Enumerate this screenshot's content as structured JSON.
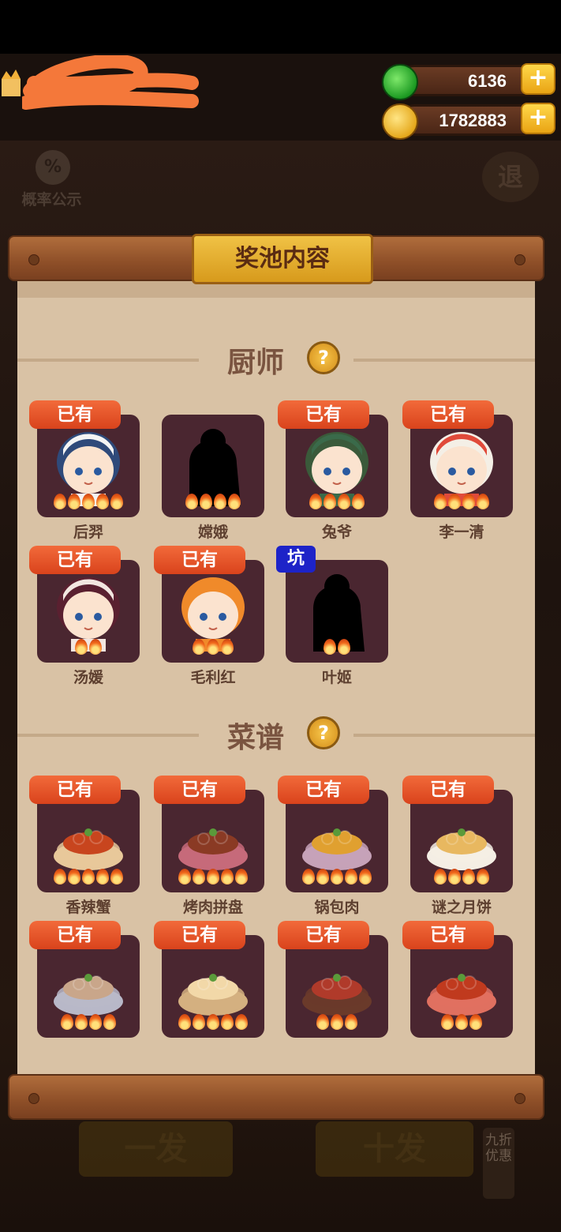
{
  "resources": {
    "gems": {
      "value": "6136",
      "icon": "green-gem-icon",
      "plus": "+"
    },
    "coins": {
      "value": "1782883",
      "icon": "gold-coin-icon",
      "plus": "+"
    }
  },
  "controls": {
    "probability": {
      "icon_text": "%",
      "label": "概率公示"
    },
    "exit": {
      "label": "退"
    }
  },
  "bottom": {
    "single": "一发",
    "ten": "十发",
    "discount": "九折优惠"
  },
  "panel": {
    "title": "奖池内容",
    "sections": {
      "chefs": {
        "title": "厨师",
        "help": "?"
      },
      "recipes": {
        "title": "菜谱",
        "help": "?"
      }
    }
  },
  "chefs": [
    {
      "name": "后羿",
      "badge": "已有",
      "stars": 5
    },
    {
      "name": "嫦娥",
      "badge": "",
      "stars": 4
    },
    {
      "name": "兔爷",
      "badge": "已有",
      "stars": 4
    },
    {
      "name": "李一清",
      "badge": "已有",
      "stars": 4
    },
    {
      "name": "汤媛",
      "badge": "已有",
      "stars": 2
    },
    {
      "name": "毛利红",
      "badge": "已有",
      "stars": 3
    },
    {
      "name": "叶姬",
      "badge_blue": "坑",
      "stars": 2
    }
  ],
  "recipes": [
    {
      "name": "香辣蟹",
      "badge": "已有",
      "stars": 5
    },
    {
      "name": "烤肉拼盘",
      "badge": "已有",
      "stars": 5
    },
    {
      "name": "锅包肉",
      "badge": "已有",
      "stars": 5
    },
    {
      "name": "谜之月饼",
      "badge": "已有",
      "stars": 4
    },
    {
      "name": "",
      "badge": "已有",
      "stars": 4
    },
    {
      "name": "",
      "badge": "已有",
      "stars": 5
    },
    {
      "name": "",
      "badge": "已有",
      "stars": 3
    },
    {
      "name": "",
      "badge": "已有",
      "stars": 3
    }
  ],
  "colors": {
    "badge_owned": "#e5522a",
    "badge_pit": "#1d23c8",
    "card_bg": "#4a2630",
    "paper": "#d9c2a5"
  }
}
